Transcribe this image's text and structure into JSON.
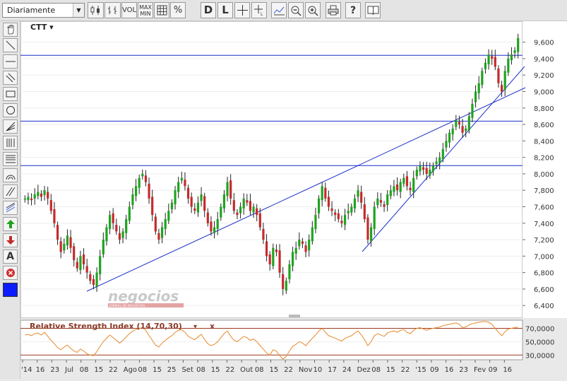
{
  "toolbar": {
    "period": "Diariamente",
    "vol": "VOL",
    "maxmin_top": "MAX",
    "maxmin_bottom": "MIN",
    "pct": "%",
    "d": "D",
    "l": "L",
    "help": "?"
  },
  "chart": {
    "symbol": "CTT ▾",
    "watermark": "negocios",
    "watermark_sub": "JORNAL DE NEGÓCIOS"
  },
  "indicator": {
    "label": "Relative Strength Index (14,70,30)",
    "dropdown": "▾",
    "close": "x"
  },
  "colors": {
    "up": "#1fa31f",
    "down": "#c42b2b",
    "line": "#1c2fc8",
    "rsi": "#e8882a",
    "rsi_bound": "#9b3b20"
  },
  "chart_data": {
    "type": "candlestick",
    "y_ticks": [
      "9,600",
      "9,400",
      "9,200",
      "9,000",
      "8,800",
      "8,600",
      "8,400",
      "8,200",
      "8,000",
      "7,800",
      "7,600",
      "7,400",
      "7,200",
      "7,000",
      "6,800",
      "6,600",
      "6,400"
    ],
    "ylim": [
      6.35,
      9.7
    ],
    "x_labels": [
      "'14",
      "16",
      "23",
      "Jul",
      "08",
      "15",
      "22",
      "Ago",
      "08",
      "15",
      "25",
      "Set",
      "08",
      "15",
      "22",
      "Out",
      "08",
      "15",
      "22",
      "Nov",
      "10",
      "17",
      "24",
      "Dez",
      "08",
      "15",
      "22",
      "'15",
      "09",
      "16",
      "23",
      "Fev",
      "09",
      "16"
    ],
    "horizontal_lines": [
      9.44,
      8.64,
      8.1
    ],
    "close_series": [
      7.7,
      7.72,
      7.68,
      7.75,
      7.78,
      7.72,
      7.8,
      7.7,
      7.55,
      7.4,
      7.2,
      7.05,
      7.15,
      7.25,
      7.1,
      6.95,
      6.85,
      7.0,
      6.9,
      6.8,
      6.7,
      6.65,
      6.8,
      7.0,
      7.2,
      7.35,
      7.5,
      7.4,
      7.3,
      7.2,
      7.3,
      7.45,
      7.6,
      7.75,
      7.85,
      7.95,
      8.0,
      7.9,
      7.7,
      7.5,
      7.3,
      7.2,
      7.35,
      7.45,
      7.55,
      7.65,
      7.8,
      7.9,
      7.95,
      7.85,
      7.7,
      7.6,
      7.55,
      7.65,
      7.75,
      7.55,
      7.4,
      7.3,
      7.35,
      7.45,
      7.6,
      7.75,
      7.9,
      7.7,
      7.55,
      7.5,
      7.6,
      7.7,
      7.65,
      7.55,
      7.6,
      7.5,
      7.35,
      7.2,
      7.0,
      6.9,
      7.1,
      7.05,
      6.8,
      6.6,
      6.7,
      6.9,
      7.05,
      7.1,
      7.2,
      7.15,
      7.05,
      7.2,
      7.35,
      7.5,
      7.7,
      7.85,
      7.7,
      7.6,
      7.55,
      7.5,
      7.45,
      7.4,
      7.5,
      7.55,
      7.6,
      7.7,
      7.8,
      7.65,
      7.45,
      7.2,
      7.35,
      7.6,
      7.7,
      7.65,
      7.6,
      7.75,
      7.8,
      7.85,
      7.8,
      7.9,
      7.95,
      7.85,
      7.8,
      7.95,
      8.05,
      8.1,
      8.05,
      8.0,
      8.05,
      8.1,
      8.15,
      8.2,
      8.3,
      8.4,
      8.5,
      8.55,
      8.65,
      8.6,
      8.5,
      8.55,
      8.7,
      8.85,
      9.0,
      9.1,
      9.25,
      9.35,
      9.45,
      9.4,
      9.3,
      9.1,
      9.0,
      9.25,
      9.4,
      9.45,
      9.5,
      9.65
    ],
    "rsi": {
      "ticks": [
        "70,0000",
        "50,0000",
        "30,0000"
      ],
      "ylim": [
        25,
        80
      ],
      "values": [
        60,
        61,
        59,
        62,
        63,
        60,
        64,
        58,
        52,
        47,
        41,
        38,
        42,
        45,
        40,
        36,
        34,
        39,
        36,
        32,
        30,
        29,
        35,
        43,
        50,
        55,
        60,
        56,
        52,
        48,
        52,
        57,
        62,
        66,
        68,
        70,
        71,
        67,
        59,
        52,
        45,
        42,
        48,
        52,
        56,
        59,
        64,
        67,
        68,
        64,
        58,
        55,
        53,
        57,
        61,
        53,
        47,
        44,
        46,
        50,
        56,
        62,
        66,
        58,
        52,
        50,
        54,
        58,
        56,
        52,
        54,
        50,
        44,
        39,
        33,
        30,
        38,
        36,
        29,
        24,
        28,
        36,
        43,
        46,
        50,
        48,
        44,
        50,
        55,
        60,
        66,
        70,
        64,
        59,
        57,
        55,
        53,
        51,
        55,
        57,
        59,
        63,
        66,
        60,
        53,
        44,
        50,
        59,
        62,
        60,
        58,
        63,
        65,
        66,
        64,
        67,
        68,
        64,
        62,
        67,
        70,
        71,
        69,
        67,
        69,
        70,
        71,
        72,
        74,
        75,
        76,
        77,
        78,
        76,
        71,
        72,
        75,
        77,
        78,
        79,
        80,
        80,
        79,
        76,
        70,
        64,
        59,
        65,
        69,
        70,
        71,
        72
      ]
    }
  }
}
